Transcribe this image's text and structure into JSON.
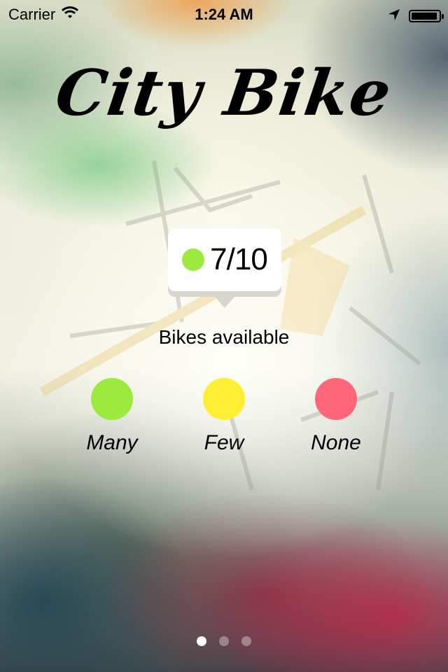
{
  "status_bar": {
    "carrier": "Carrier",
    "time": "1:24 AM",
    "battery_level": 0.95
  },
  "app": {
    "title": "City Bike"
  },
  "station": {
    "available": "7/10",
    "status_color": "#9cea3d",
    "label": "Bikes available"
  },
  "legend": {
    "items": [
      {
        "label": "Many",
        "color": "#9cea3d"
      },
      {
        "label": "Few",
        "color": "#ffee33"
      },
      {
        "label": "None",
        "color": "#ff6677"
      }
    ]
  },
  "pager": {
    "pages": 3,
    "current": 1
  }
}
